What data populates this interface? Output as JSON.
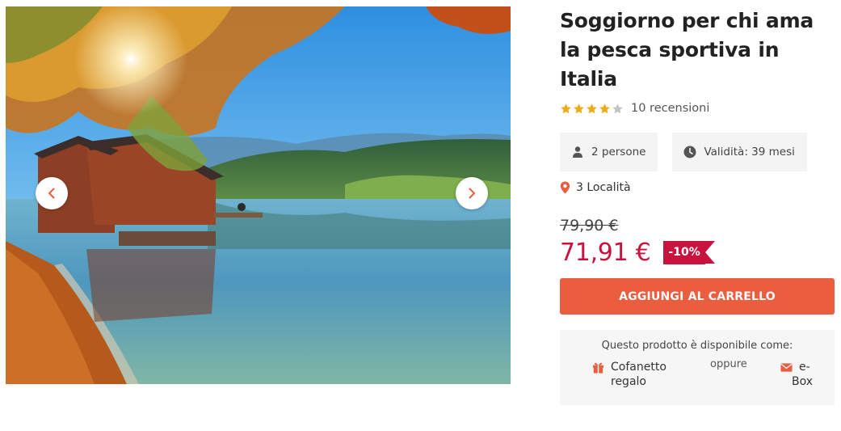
{
  "gallery": {
    "image_alt": "Lake with boathouse and autumn trees",
    "prev_icon": "chevron-left-icon",
    "next_icon": "chevron-right-icon"
  },
  "product": {
    "title": "Soggiorno per chi ama la pesca sportiva in Italia",
    "rating": 4,
    "rating_max": 5,
    "reviews_label": "10 recensioni",
    "people_label": "2 persone",
    "validity_label": "Validità: 39 mesi",
    "locations_label": "3 Località",
    "old_price": "79,90 €",
    "new_price": "71,91 €",
    "discount": "-10%",
    "add_to_cart_label": "AGGIUNGI AL CARRELLO"
  },
  "availability": {
    "title": "Questo prodotto è disponibile come:",
    "option_box": "Cofanetto regalo",
    "or_label": "oppure",
    "option_ebox_line1": "e-",
    "option_ebox_line2": "Box"
  },
  "colors": {
    "accent": "#eb5d3f",
    "price": "#c8133f",
    "star": "#f0a81c",
    "star_empty": "#c4c4c4"
  }
}
